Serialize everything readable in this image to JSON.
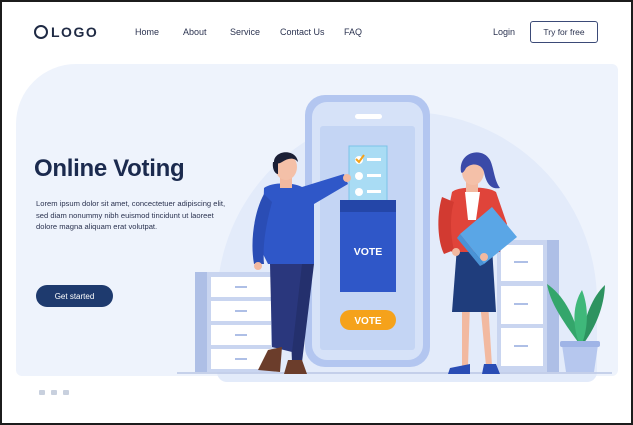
{
  "brand": {
    "logo_text": "LOGO"
  },
  "nav": {
    "items": [
      {
        "label": "Home"
      },
      {
        "label": "About"
      },
      {
        "label": "Service"
      },
      {
        "label": "Contact Us"
      },
      {
        "label": "FAQ"
      }
    ],
    "login_label": "Login",
    "cta_label": "Try for free"
  },
  "hero": {
    "title": "Online Voting",
    "description": "Lorem ipsum dolor sit amet, concectetuer adipiscing elit, sed diam nonummy nibh euismod tincidunt ut laoreet dolore magna aliquam erat volutpat.",
    "button_label": "Get started"
  },
  "illustration": {
    "ballot_box_label": "VOTE",
    "vote_button_label": "VOTE"
  },
  "colors": {
    "primary_dark": "#1e3a6e",
    "accent_blue": "#2f57c8",
    "accent_orange": "#f5a21b",
    "accent_red": "#e0443a",
    "background_light": "#eef3fc"
  }
}
